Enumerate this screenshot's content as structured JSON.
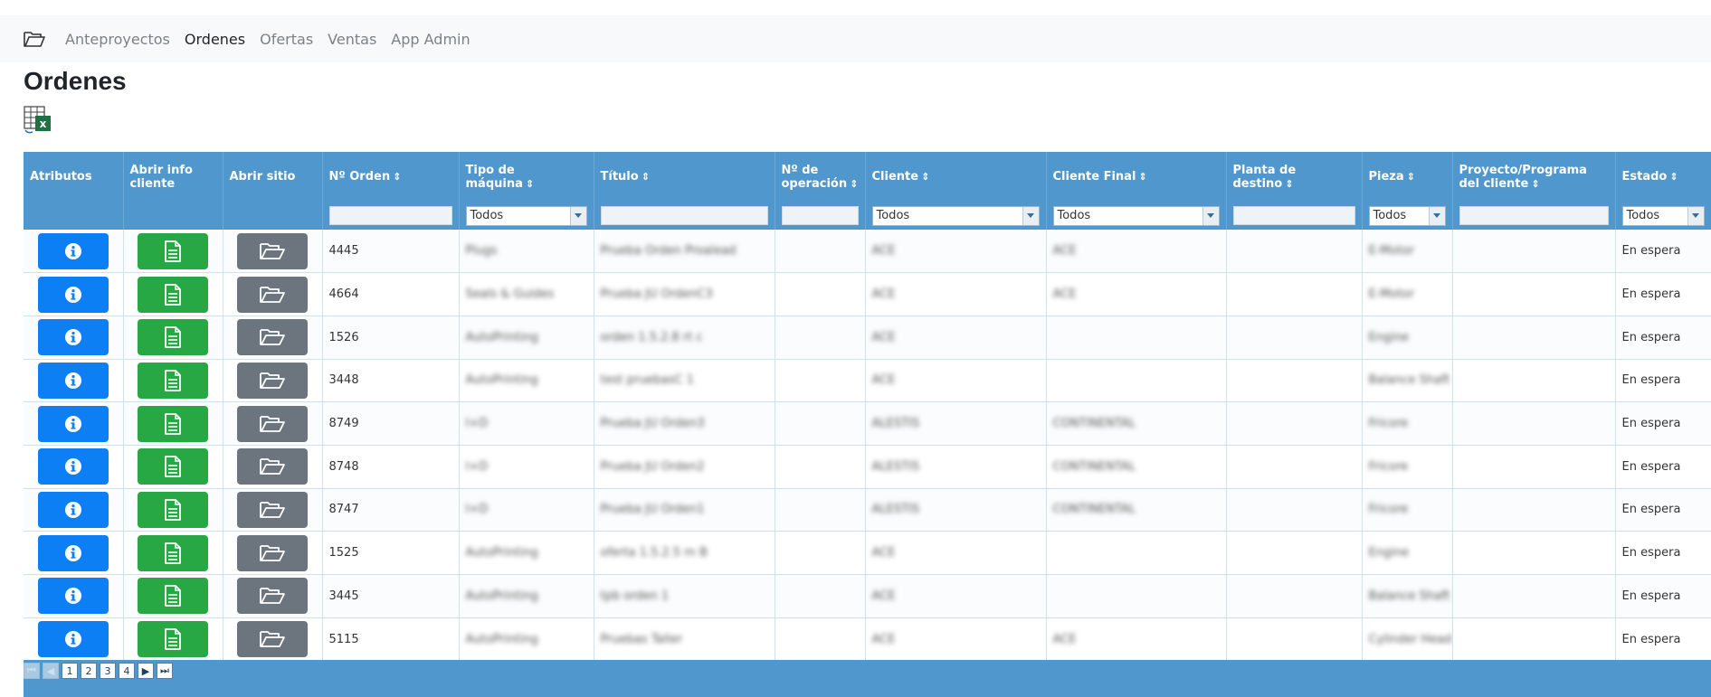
{
  "nav": {
    "items": [
      {
        "label": "Anteproyectos",
        "active": false
      },
      {
        "label": "Ordenes",
        "active": true
      },
      {
        "label": "Ofertas",
        "active": false
      },
      {
        "label": "Ventas",
        "active": false
      },
      {
        "label": "App Admin",
        "active": false
      }
    ],
    "brand_icon": "folder-open-icon"
  },
  "page": {
    "title": "Ordenes",
    "export_icon": "excel-export-icon"
  },
  "grid": {
    "columns": [
      {
        "label": "Atributos",
        "sortable": false
      },
      {
        "label": "Abrir info cliente",
        "sortable": false
      },
      {
        "label": "Abrir sitio",
        "sortable": false
      },
      {
        "label": "Nº Orden",
        "sortable": true
      },
      {
        "label": "Tipo de máquina",
        "sortable": true
      },
      {
        "label": "Título",
        "sortable": true
      },
      {
        "label": "Nº de operación",
        "sortable": true
      },
      {
        "label": "Cliente",
        "sortable": true
      },
      {
        "label": "Cliente Final",
        "sortable": true
      },
      {
        "label": "Planta de destino",
        "sortable": true
      },
      {
        "label": "Pieza",
        "sortable": true
      },
      {
        "label": "Proyecto/Programa del cliente",
        "sortable": true
      },
      {
        "label": "Estado",
        "sortable": true
      }
    ],
    "filters": {
      "tipo": "Todos",
      "cliente": "Todos",
      "cliente_final": "Todos",
      "pieza": "Todos",
      "estado": "Todos"
    },
    "rows": [
      {
        "orden": "4445",
        "tipo": "Plugs",
        "titulo": "Prueba Orden Proalead",
        "cliente": "ACE",
        "cliente_final": "ACE",
        "pieza": "E-Motor",
        "estado": "En espera"
      },
      {
        "orden": "4664",
        "tipo": "Seals & Guides",
        "titulo": "Prueba JU OrdenC3",
        "cliente": "ACE",
        "cliente_final": "ACE",
        "pieza": "E-Motor",
        "estado": "En espera"
      },
      {
        "orden": "1526",
        "tipo": "AutoPrinting",
        "titulo": "orden 1.5.2.8 rt c",
        "cliente": "ACE",
        "cliente_final": "",
        "pieza": "Engine",
        "estado": "En espera"
      },
      {
        "orden": "3448",
        "tipo": "AutoPrinting",
        "titulo": "test pruebasC 1",
        "cliente": "ACE",
        "cliente_final": "",
        "pieza": "Balance Shaft",
        "estado": "En espera"
      },
      {
        "orden": "8749",
        "tipo": "I+D",
        "titulo": "Prueba JU Orden3",
        "cliente": "ALESTIS",
        "cliente_final": "CONTINENTAL",
        "pieza": "Fricore",
        "estado": "En espera"
      },
      {
        "orden": "8748",
        "tipo": "I+D",
        "titulo": "Prueba JU Orden2",
        "cliente": "ALESTIS",
        "cliente_final": "CONTINENTAL",
        "pieza": "Fricore",
        "estado": "En espera"
      },
      {
        "orden": "8747",
        "tipo": "I+D",
        "titulo": "Prueba JU Orden1",
        "cliente": "ALESTIS",
        "cliente_final": "CONTINENTAL",
        "pieza": "Fricore",
        "estado": "En espera"
      },
      {
        "orden": "1525",
        "tipo": "AutoPrinting",
        "titulo": "oferta 1.5.2.5 m B",
        "cliente": "ACE",
        "cliente_final": "",
        "pieza": "Engine",
        "estado": "En espera"
      },
      {
        "orden": "3445",
        "tipo": "AutoPrinting",
        "titulo": "tpb orden 1",
        "cliente": "ACE",
        "cliente_final": "",
        "pieza": "Balance Shaft",
        "estado": "En espera"
      },
      {
        "orden": "5115",
        "tipo": "AutoPrinting",
        "titulo": "Pruebas Taller",
        "cliente": "ACE",
        "cliente_final": "ACE",
        "pieza": "Cylinder Head",
        "estado": "En espera"
      }
    ],
    "row_icons": {
      "info": "info-circle-icon",
      "doc": "document-icon",
      "open": "folder-open-icon"
    }
  },
  "pager": {
    "pages": [
      "1",
      "2",
      "3",
      "4"
    ]
  },
  "colors": {
    "header": "#4f97cc",
    "info_btn": "#0d7ff5",
    "doc_btn": "#28a745",
    "open_btn": "#6c757d"
  }
}
